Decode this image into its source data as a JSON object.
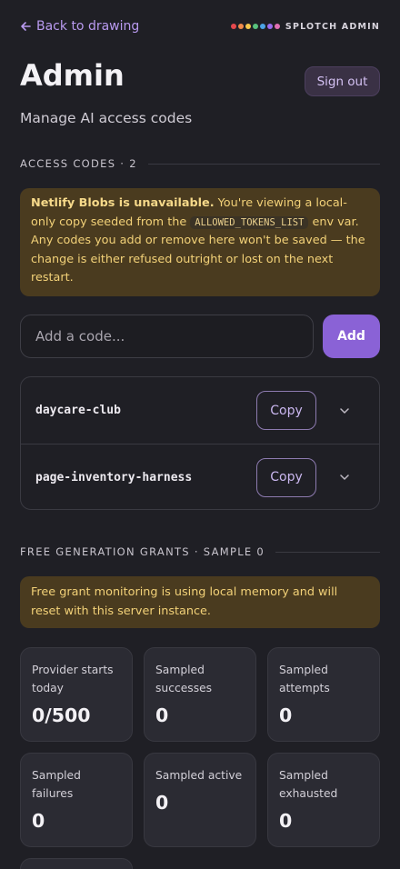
{
  "topbar": {
    "back_label": "Back to drawing",
    "brand_label": "SPLOTCH ADMIN",
    "brand_dots": [
      "#e5484d",
      "#f08a4b",
      "#f5c84c",
      "#58c27d",
      "#4ca3e6",
      "#9b6cf0",
      "#e26fb4"
    ]
  },
  "header": {
    "title": "Admin",
    "signout_label": "Sign out",
    "subtitle": "Manage AI access codes"
  },
  "access_codes": {
    "section_label": "ACCESS CODES · 2",
    "warning_bold": "Netlify Blobs is unavailable.",
    "warning_pre": " You're viewing a local-only copy seeded from the ",
    "warning_code": "ALLOWED_TOKENS_LIST",
    "warning_post": " env var. Any codes you add or remove here won't be saved — the change is either refused outright or lost on the next restart.",
    "input_placeholder": "Add a code...",
    "add_label": "Add",
    "copy_label": "Copy",
    "codes": [
      "daycare-club",
      "page-inventory-harness"
    ]
  },
  "grants": {
    "section_label": "FREE GENERATION GRANTS · SAMPLE 0",
    "warning": "Free grant monitoring is using local memory and will reset with this server instance.",
    "stats": [
      {
        "label": "Provider starts today",
        "value": "0/500"
      },
      {
        "label": "Sampled successes",
        "value": "0"
      },
      {
        "label": "Sampled attempts",
        "value": "0"
      },
      {
        "label": "Sampled failures",
        "value": "0"
      },
      {
        "label": "Sampled active",
        "value": "0"
      },
      {
        "label": "Sampled exhausted",
        "value": "0"
      }
    ]
  }
}
